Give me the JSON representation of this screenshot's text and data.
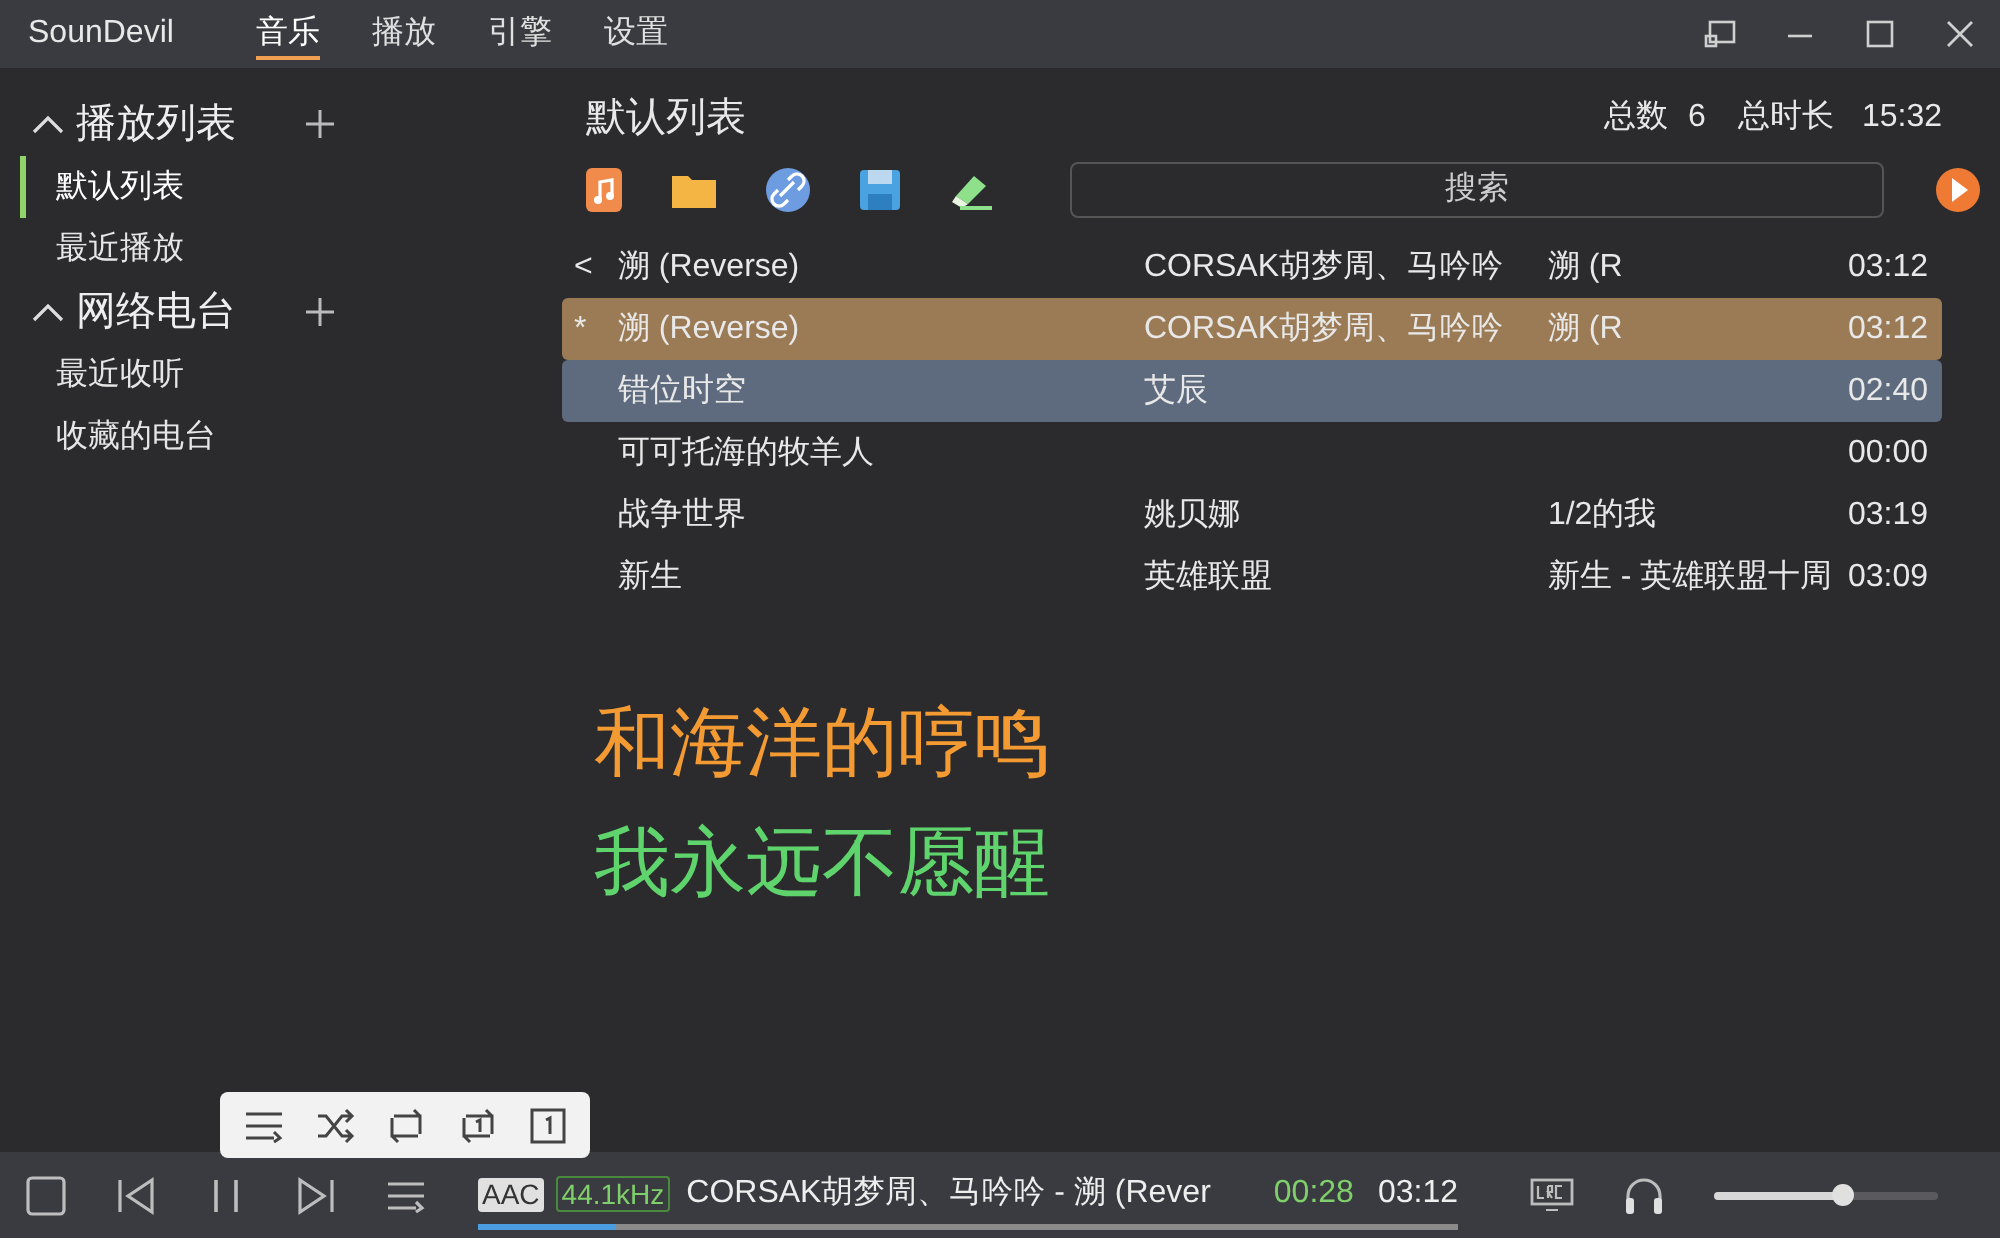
{
  "app_name": "SounDevil",
  "tabs": [
    {
      "label": "音乐",
      "selected": true
    },
    {
      "label": "播放",
      "selected": false
    },
    {
      "label": "引擎",
      "selected": false
    },
    {
      "label": "设置",
      "selected": false
    }
  ],
  "sidebar": {
    "sections": [
      {
        "title": "播放列表",
        "expanded": true,
        "items": [
          {
            "label": "默认列表",
            "selected": true
          },
          {
            "label": "最近播放",
            "selected": false
          }
        ]
      },
      {
        "title": "网络电台",
        "expanded": true,
        "items": [
          {
            "label": "最近收听",
            "selected": false
          },
          {
            "label": "收藏的电台",
            "selected": false
          }
        ]
      }
    ]
  },
  "playlist": {
    "title": "默认列表",
    "count_label": "总数",
    "count": "6",
    "duration_label": "总时长",
    "duration": "15:32",
    "search": {
      "placeholder": "搜索"
    },
    "rows": [
      {
        "marker": "<",
        "title": "溯 (Reverse)",
        "artist": "CORSAK胡梦周、马吟吟",
        "album": "溯 (R",
        "duration": "03:12",
        "playing": false,
        "selected": false
      },
      {
        "marker": "*",
        "title": "溯 (Reverse)",
        "artist": "CORSAK胡梦周、马吟吟",
        "album": "溯 (R",
        "duration": "03:12",
        "playing": true,
        "selected": false
      },
      {
        "title": "错位时空",
        "artist": "艾辰",
        "duration": "02:40",
        "playing": false,
        "selected": true
      },
      {
        "title": "可可托海的牧羊人",
        "duration": "00:00",
        "playing": false,
        "selected": false
      },
      {
        "title": "战争世界",
        "artist": "姚贝娜",
        "album": "1/2的我",
        "duration": "03:19",
        "playing": false,
        "selected": false
      },
      {
        "title": "新生",
        "artist": "英雄联盟",
        "album": "新生 - 英雄联盟十周",
        "duration": "03:09",
        "playing": false,
        "selected": false
      }
    ]
  },
  "lyrics": [
    {
      "text": "和海洋的哼鸣",
      "color": "#f39a32"
    },
    {
      "text": "我永远不愿醒",
      "color": "#5fd46c"
    }
  ],
  "player": {
    "format": "AAC",
    "sample_rate": "44.1kHz",
    "now_playing": "CORSAK胡梦周、马吟吟 - 溯 (Rever",
    "elapsed": "00:28",
    "total": "03:12",
    "progress": {
      "level": 0.14
    },
    "volume": {
      "level": 0.57
    }
  }
}
